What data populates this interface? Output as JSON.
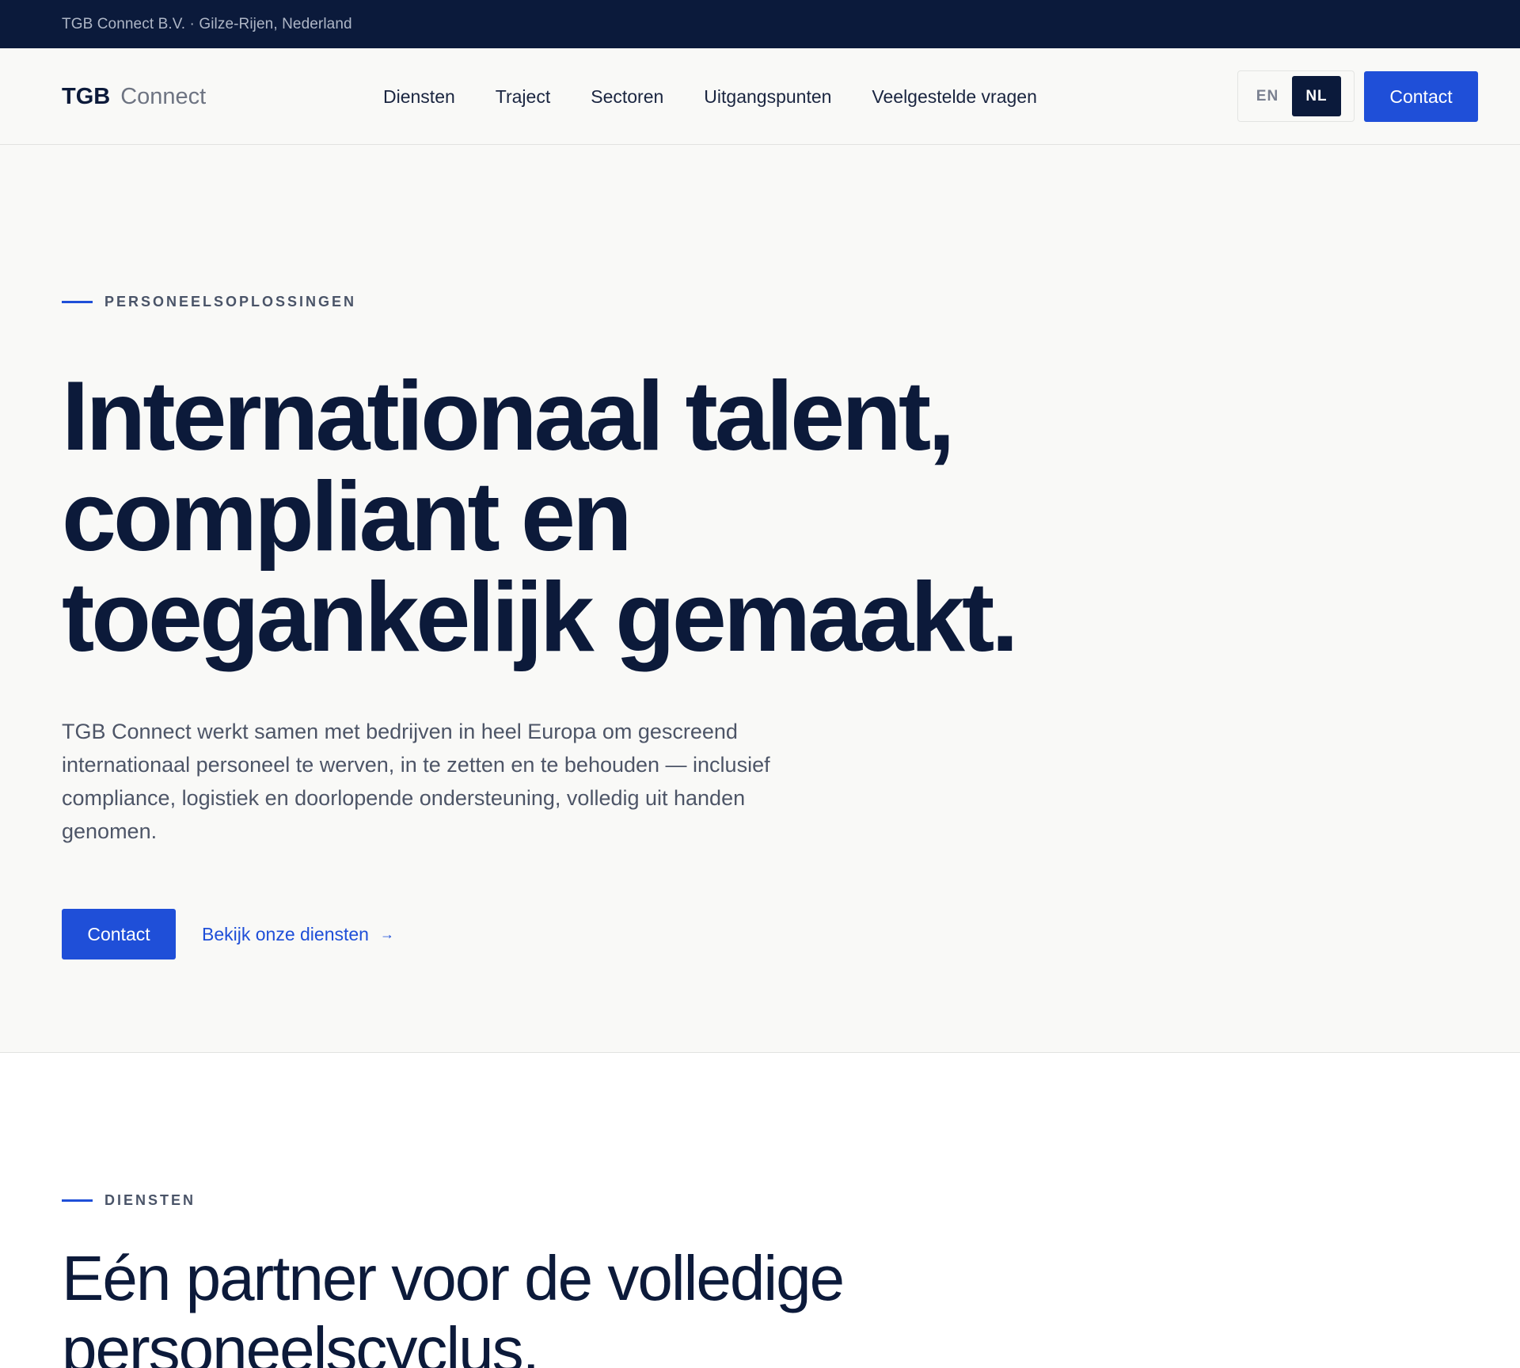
{
  "topbar": {
    "text": "TGB Connect B.V. · Gilze-Rijen, Nederland"
  },
  "header": {
    "logo_strong": "TGB",
    "logo_light": "Connect",
    "nav": [
      {
        "label": "Diensten"
      },
      {
        "label": "Traject"
      },
      {
        "label": "Sectoren"
      },
      {
        "label": "Uitgangspunten"
      },
      {
        "label": "Veelgestelde vragen"
      }
    ],
    "lang": {
      "en": "EN",
      "nl": "NL",
      "active": "NL"
    },
    "contact_label": "Contact"
  },
  "hero": {
    "eyebrow": "PERSONEELSOPLOSSINGEN",
    "title_line1": "Internationaal talent,",
    "title_line2": "compliant en",
    "title_line3": "toegankelijk gemaakt.",
    "text": "TGB Connect werkt samen met bedrijven in heel Europa om gescreend internationaal personeel te werven, in te zetten en te behouden — inclusief compliance, logistiek en doorlopende ondersteuning, volledig uit handen genomen.",
    "contact_label": "Contact",
    "services_link": "Bekijk onze diensten",
    "services_link_arrow": "→"
  },
  "services": {
    "eyebrow": "DIENSTEN",
    "title_line1": "Eén partner voor de volledige",
    "title_line2": "personeelscyclus."
  },
  "colors": {
    "navy": "#0b1a3b",
    "accent": "#1f4fd8",
    "background": "#f9f9f7",
    "text_muted": "#4d5567"
  }
}
